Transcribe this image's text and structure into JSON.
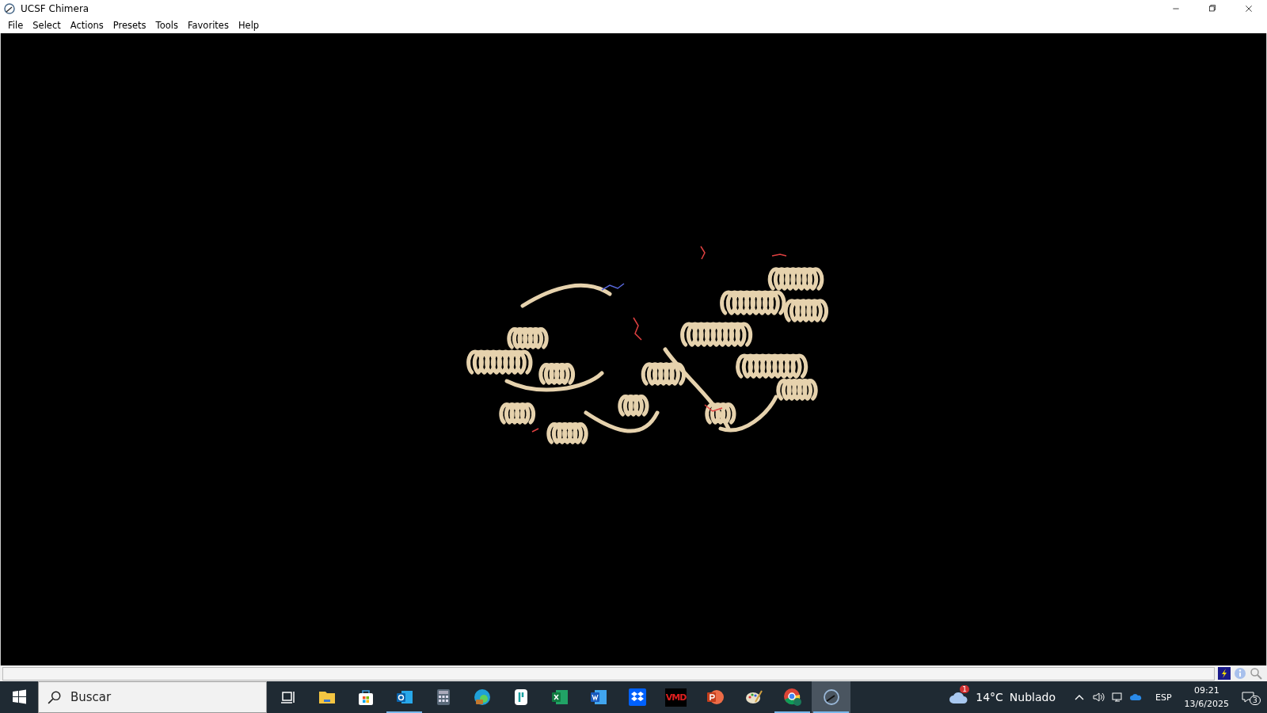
{
  "window": {
    "title": "UCSF Chimera"
  },
  "menu": [
    "File",
    "Select",
    "Actions",
    "Presets",
    "Tools",
    "Favorites",
    "Help"
  ],
  "taskbar": {
    "search": {
      "placeholder": "Buscar"
    },
    "apps": [
      {
        "kind": "taskview",
        "running": false,
        "selected": false
      },
      {
        "kind": "explorer",
        "running": false,
        "selected": false
      },
      {
        "kind": "store",
        "running": false,
        "selected": false
      },
      {
        "kind": "outlook",
        "running": true,
        "selected": false
      },
      {
        "kind": "calculator",
        "running": false,
        "selected": false
      },
      {
        "kind": "edge",
        "running": false,
        "selected": false
      },
      {
        "kind": "teal",
        "running": false,
        "selected": false
      },
      {
        "kind": "excel",
        "running": false,
        "selected": false
      },
      {
        "kind": "word",
        "running": false,
        "selected": false
      },
      {
        "kind": "dropbox",
        "running": false,
        "selected": false
      },
      {
        "kind": "vmd",
        "label": "VMD",
        "running": false,
        "selected": false
      },
      {
        "kind": "powerpoint",
        "running": false,
        "selected": false
      },
      {
        "kind": "paint",
        "running": false,
        "selected": false
      },
      {
        "kind": "chrome",
        "running": true,
        "selected": false
      },
      {
        "kind": "chimera",
        "running": true,
        "selected": true
      }
    ],
    "weather": {
      "badge": "1",
      "temperature": "14°C",
      "condition": "Nublado"
    },
    "language": "ESP",
    "time": "09:21",
    "date": "13/6/2025",
    "notifications": "3"
  }
}
